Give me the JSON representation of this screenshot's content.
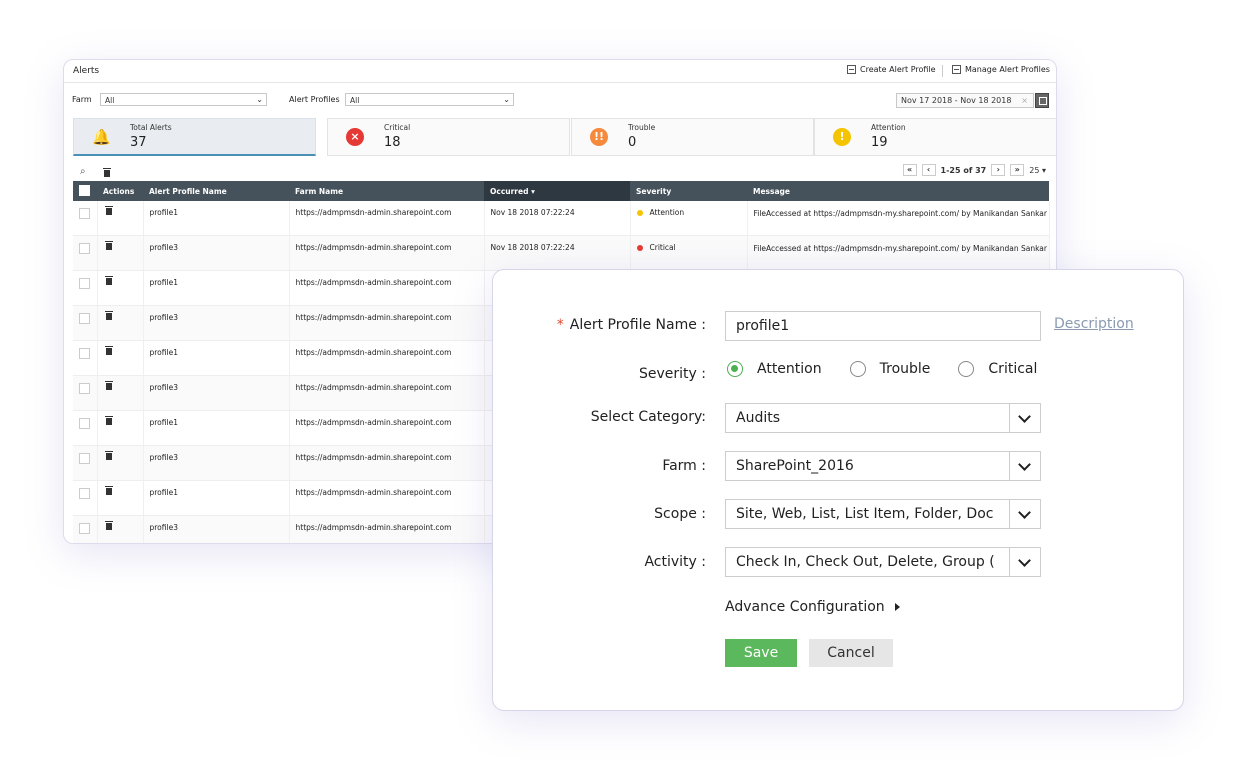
{
  "alerts_panel": {
    "title": "Alerts",
    "create_profile_label": "Create Alert Profile",
    "manage_profiles_label": "Manage Alert Profiles",
    "farm_label": "Farm",
    "farm_value": "All",
    "alert_profiles_label": "Alert Profiles",
    "alert_profiles_value": "All",
    "date_range": "Nov 17 2018 - Nov 18 2018",
    "stats": [
      {
        "label": "Total Alerts",
        "value": "37",
        "color": "#4a8fb5"
      },
      {
        "label": "Critical",
        "value": "18",
        "color": "#e53935"
      },
      {
        "label": "Trouble",
        "value": "0",
        "color": "#f58a3d"
      },
      {
        "label": "Attention",
        "value": "19",
        "color": "#f5c400"
      }
    ],
    "pager": {
      "range": "1-25 of 37",
      "page_size": "25"
    },
    "columns": [
      "Actions",
      "Alert Profile Name",
      "Farm Name",
      "Occurred",
      "Severity",
      "Message"
    ],
    "rows": [
      {
        "profile": "profile1",
        "farm": "https://admpmsdn-admin.sharepoint.com",
        "occurred": "Nov 18 2018 07:22:24",
        "severity": "Attention",
        "severity_color": "#f5c400",
        "message": "FileAccessed at https://admpmsdn-my.sharepoint.com/ by Manikandan Sankar"
      },
      {
        "profile": "profile3",
        "farm": "https://admpmsdn-admin.sharepoint.com",
        "occurred": "Nov 18 2018 07:22:24",
        "severity": "Critical",
        "severity_color": "#e53935",
        "message": "FileAccessed at https://admpmsdn-my.sharepoint.com/ by Manikandan Sankar"
      },
      {
        "profile": "profile1",
        "farm": "https://admpmsdn-admin.sharepoint.com"
      },
      {
        "profile": "profile3",
        "farm": "https://admpmsdn-admin.sharepoint.com"
      },
      {
        "profile": "profile1",
        "farm": "https://admpmsdn-admin.sharepoint.com"
      },
      {
        "profile": "profile3",
        "farm": "https://admpmsdn-admin.sharepoint.com"
      },
      {
        "profile": "profile1",
        "farm": "https://admpmsdn-admin.sharepoint.com"
      },
      {
        "profile": "profile3",
        "farm": "https://admpmsdn-admin.sharepoint.com"
      },
      {
        "profile": "profile1",
        "farm": "https://admpmsdn-admin.sharepoint.com"
      },
      {
        "profile": "profile3",
        "farm": "https://admpmsdn-admin.sharepoint.com"
      }
    ]
  },
  "dialog": {
    "name_label": "Alert Profile Name :",
    "name_value": "profile1",
    "description_link": "Description",
    "severity_label": "Severity :",
    "severity_options": [
      "Attention",
      "Trouble",
      "Critical"
    ],
    "severity_selected": "Attention",
    "category_label": "Select Category:",
    "category_value": "Audits",
    "farm_label": "Farm :",
    "farm_value": "SharePoint_2016",
    "scope_label": "Scope :",
    "scope_value": "Site, Web, List, List Item, Folder, Doc",
    "activity_label": "Activity :",
    "activity_value": "Check In, Check Out, Delete, Group (",
    "advance_label": "Advance Configuration",
    "save_label": "Save",
    "cancel_label": "Cancel"
  }
}
